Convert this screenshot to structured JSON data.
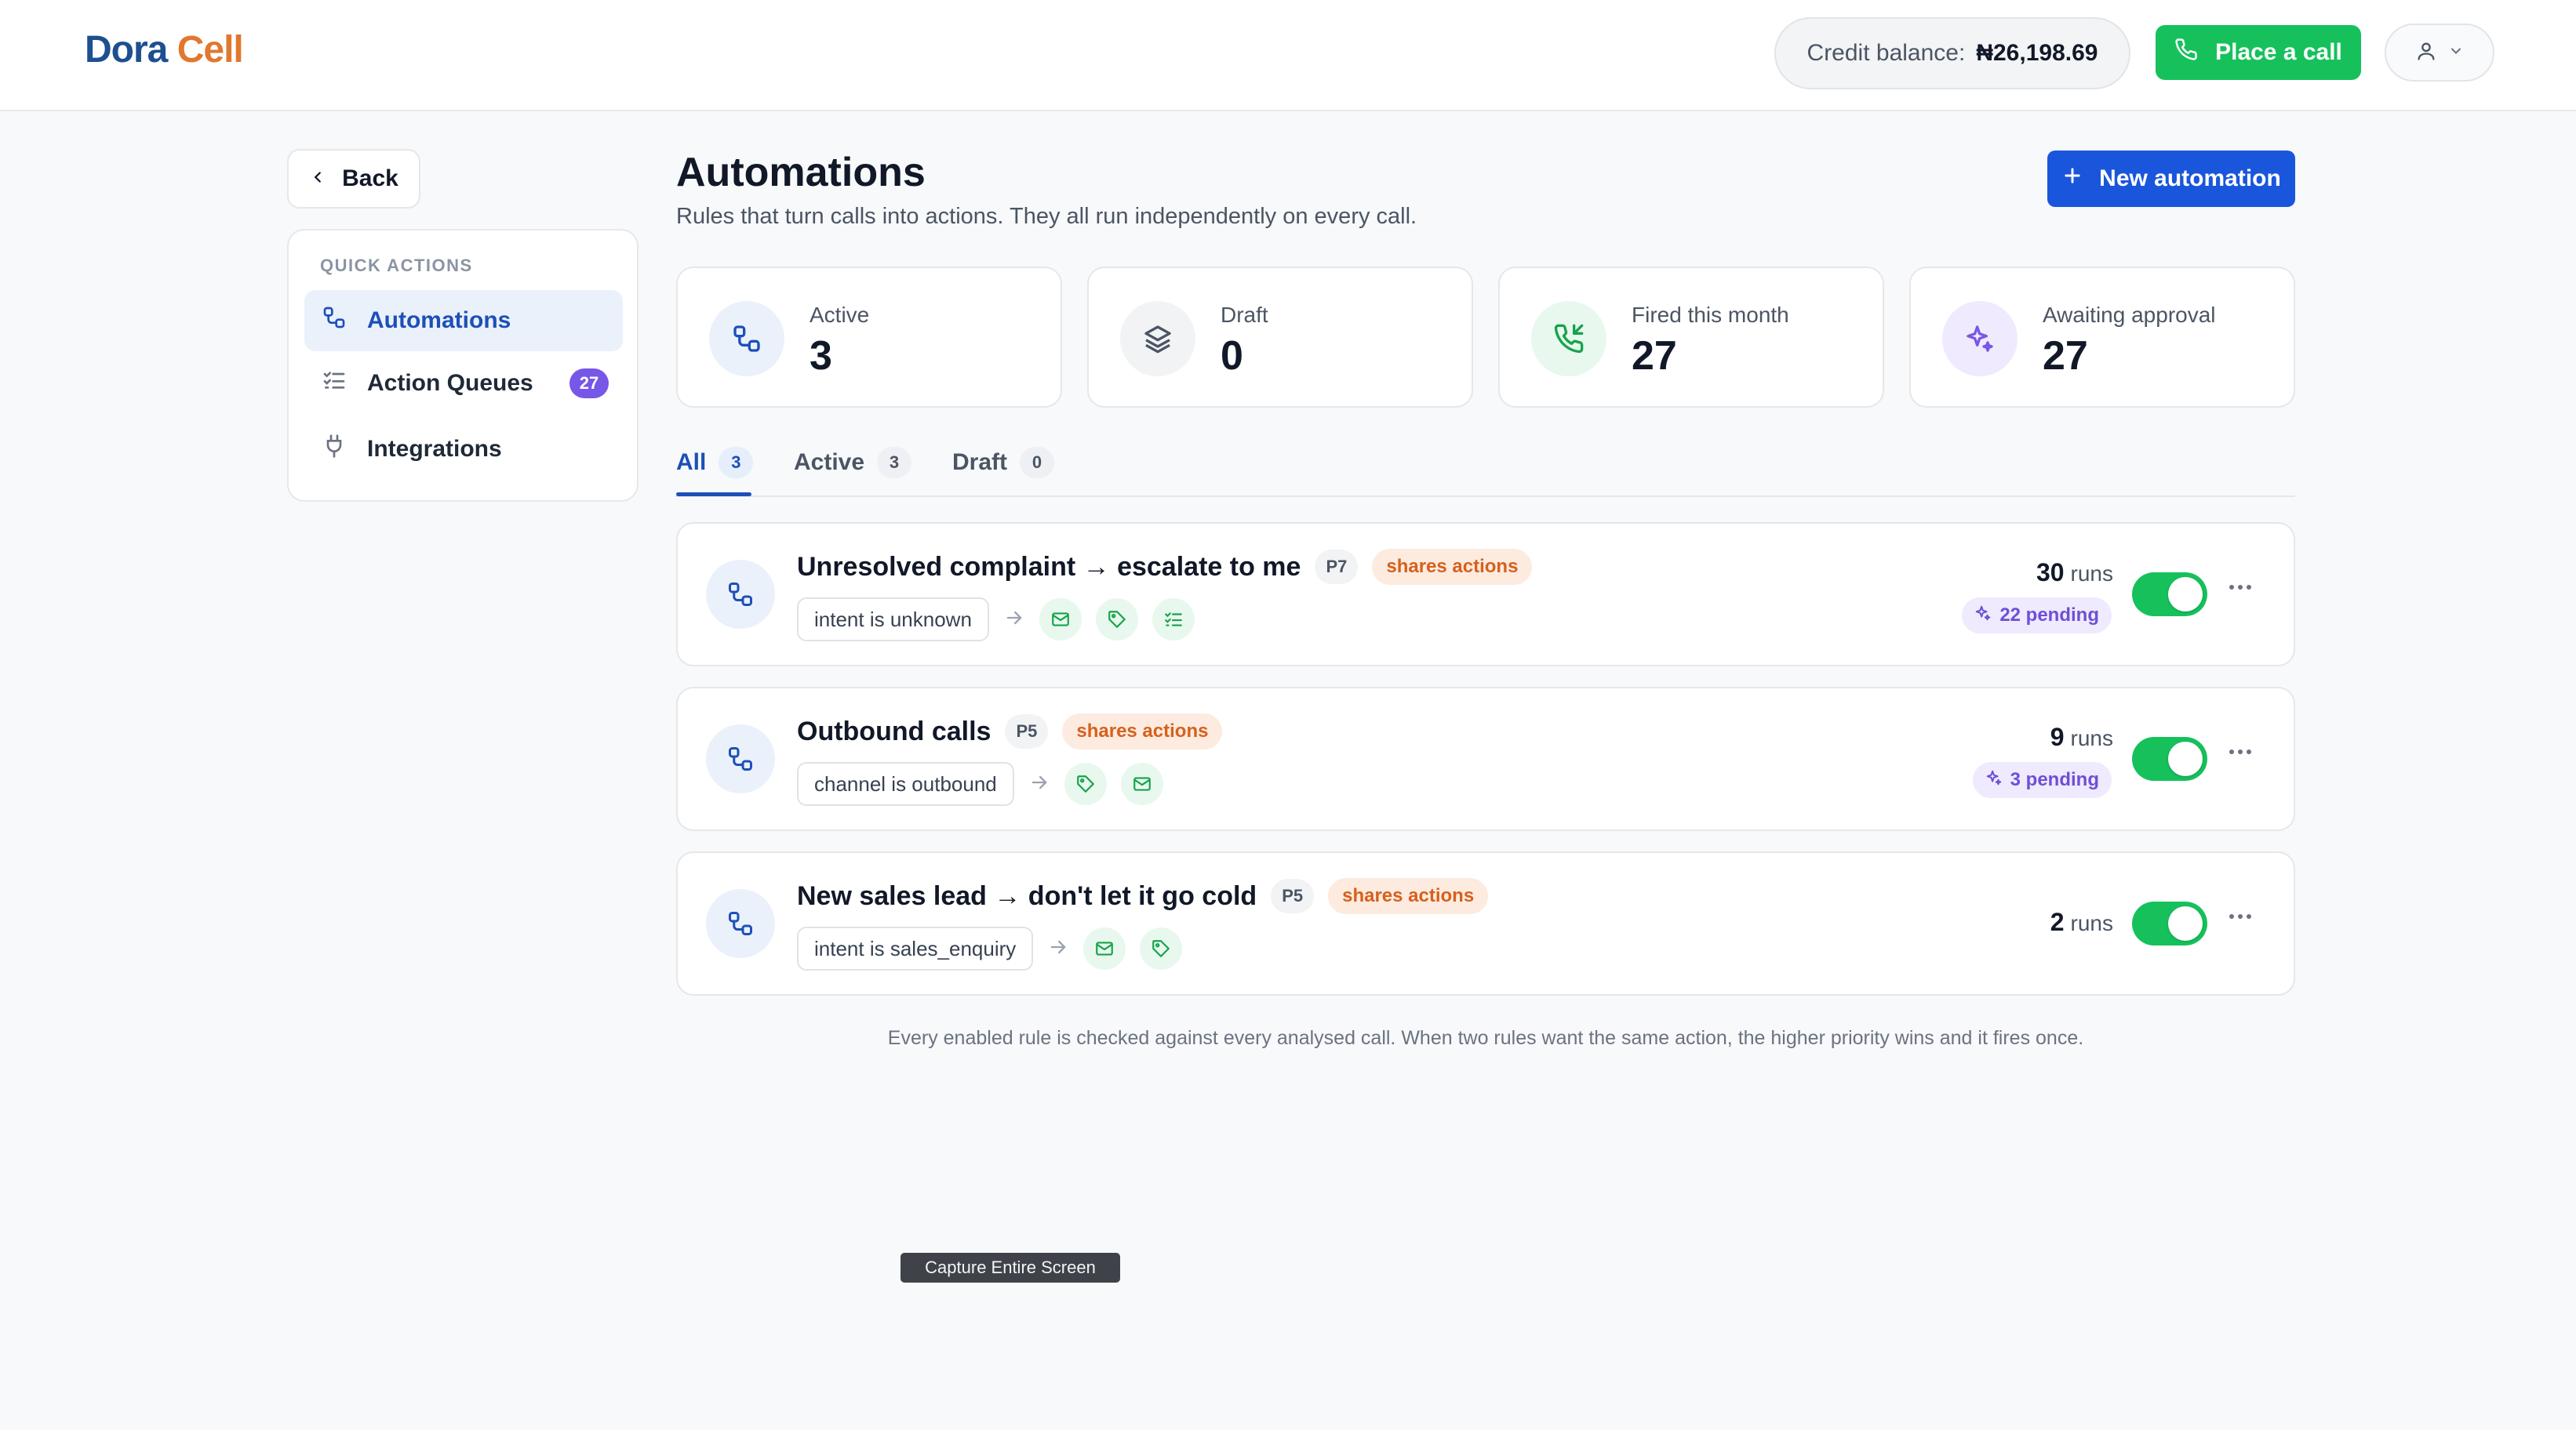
{
  "brand": {
    "name_part1": "Dora",
    "name_part2": "Cell",
    "color_primary": "#1d4f91",
    "color_accent": "#e0782f"
  },
  "header": {
    "credit_label": "Credit balance:",
    "credit_value": "₦26,198.69",
    "place_call_label": "Place a call",
    "place_call_icon": "phone-icon",
    "profile_icon": "user-icon"
  },
  "sidebar": {
    "back_label": "Back",
    "heading": "QUICK ACTIONS",
    "items": [
      {
        "label": "Automations",
        "icon": "automation-icon",
        "active": true
      },
      {
        "label": "Action Queues",
        "icon": "checklist-icon",
        "badge": "27"
      },
      {
        "label": "Integrations",
        "icon": "plug-icon"
      }
    ]
  },
  "main": {
    "title": "Automations",
    "subtitle": "Rules that turn calls into actions. They all run independently on every call.",
    "new_button_label": "New automation",
    "stats": [
      {
        "label": "Active",
        "value": "3",
        "icon": "automation-icon",
        "color": "#eaf1fb"
      },
      {
        "label": "Draft",
        "value": "0",
        "icon": "layers-icon",
        "color": "#f1f3f5"
      },
      {
        "label": "Fired this month",
        "value": "27",
        "icon": "phone-incoming-icon",
        "color": "#e8f8ee"
      },
      {
        "label": "Awaiting approval",
        "value": "27",
        "icon": "sparkles-icon",
        "color": "#efeafd"
      }
    ],
    "tabs": [
      {
        "label": "All",
        "count": "3",
        "active": true
      },
      {
        "label": "Active",
        "count": "3"
      },
      {
        "label": "Draft",
        "count": "0"
      }
    ],
    "rules": [
      {
        "name": "Unresolved complaint → escalate to me",
        "priority": "P7",
        "shares_label": "shares actions",
        "condition": "intent is unknown",
        "actions": [
          "mail-icon",
          "tag-icon",
          "checklist-icon"
        ],
        "runs": "30",
        "runs_unit": "runs",
        "pending": "22 pending",
        "enabled": true
      },
      {
        "name": "Outbound calls",
        "priority": "P5",
        "shares_label": "shares actions",
        "condition": "channel is outbound",
        "actions": [
          "tag-icon",
          "mail-icon"
        ],
        "runs": "9",
        "runs_unit": "runs",
        "pending": "3 pending",
        "enabled": true
      },
      {
        "name": "New sales lead → don't let it go cold",
        "priority": "P5",
        "shares_label": "shares actions",
        "condition": "intent is sales_enquiry",
        "actions": [
          "mail-icon",
          "tag-icon"
        ],
        "runs": "2",
        "runs_unit": "runs",
        "enabled": true
      }
    ],
    "footnote": "Every enabled rule is checked against every analysed call. When two rules want the same action, the higher priority wins and it fires once."
  },
  "tooltip": "Capture Entire Screen",
  "colors": {
    "green": "#16c15c",
    "blue": "#1a56db",
    "purple": "#7657e8",
    "orange": "#d5611d"
  }
}
